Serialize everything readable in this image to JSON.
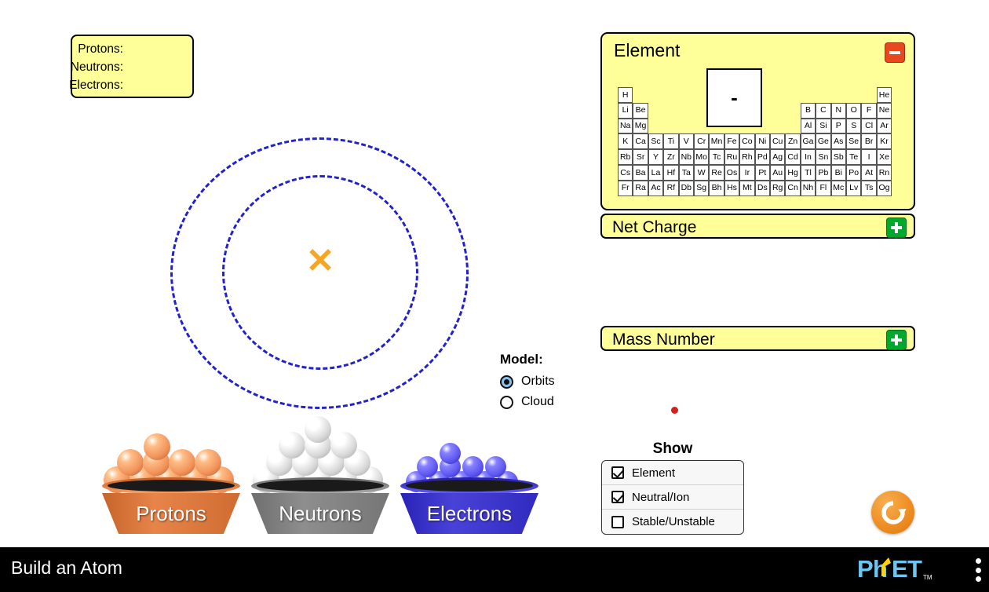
{
  "sim": {
    "title": "Build an Atom",
    "logo_text": "PhET",
    "menu_icon": "kebab-menu-icon"
  },
  "particle_counts": {
    "protons_label": "Protons:",
    "neutrons_label": "Neutrons:",
    "electrons_label": "Electrons:",
    "protons_value": "",
    "neutrons_value": "",
    "electrons_value": ""
  },
  "atom": {
    "center_marker": "✕",
    "center_marker_color": "#f5a623",
    "orbit_color": "#2222cc",
    "orbit_count": 2
  },
  "model": {
    "title": "Model:",
    "options": [
      {
        "label": "Orbits",
        "selected": true
      },
      {
        "label": "Cloud",
        "selected": false
      }
    ]
  },
  "buckets": [
    {
      "label": "Protons",
      "color": "#d9763c",
      "ball_color": "#f2935c"
    },
    {
      "label": "Neutrons",
      "color": "#808080",
      "ball_color": "#d8d8d8"
    },
    {
      "label": "Electrons",
      "color": "#3b34c9",
      "ball_color": "#5d57f0"
    }
  ],
  "element_panel": {
    "title": "Element",
    "collapse_icon": "minus-icon",
    "collapse_color": "#e8471f",
    "symbol": "-",
    "periodic_table": {
      "rows": [
        [
          "H",
          "",
          "",
          "",
          "",
          "",
          "",
          "",
          "",
          "",
          "",
          "",
          "",
          "",
          "",
          "",
          "",
          "He"
        ],
        [
          "Li",
          "Be",
          "",
          "",
          "",
          "",
          "",
          "",
          "",
          "",
          "",
          "",
          "B",
          "C",
          "N",
          "O",
          "F",
          "Ne"
        ],
        [
          "Na",
          "Mg",
          "",
          "",
          "",
          "",
          "",
          "",
          "",
          "",
          "",
          "",
          "Al",
          "Si",
          "P",
          "S",
          "Cl",
          "Ar"
        ],
        [
          "K",
          "Ca",
          "Sc",
          "Ti",
          "V",
          "Cr",
          "Mn",
          "Fe",
          "Co",
          "Ni",
          "Cu",
          "Zn",
          "Ga",
          "Ge",
          "As",
          "Se",
          "Br",
          "Kr"
        ],
        [
          "Rb",
          "Sr",
          "Y",
          "Zr",
          "Nb",
          "Mo",
          "Tc",
          "Ru",
          "Rh",
          "Pd",
          "Ag",
          "Cd",
          "In",
          "Sn",
          "Sb",
          "Te",
          "I",
          "Xe"
        ],
        [
          "Cs",
          "Ba",
          "La",
          "Hf",
          "Ta",
          "W",
          "Re",
          "Os",
          "Ir",
          "Pt",
          "Au",
          "Hg",
          "Tl",
          "Pb",
          "Bi",
          "Po",
          "At",
          "Rn"
        ],
        [
          "Fr",
          "Ra",
          "Ac",
          "Rf",
          "Db",
          "Sg",
          "Bh",
          "Hs",
          "Mt",
          "Ds",
          "Rg",
          "Cn",
          "Nh",
          "Fl",
          "Mc",
          "Lv",
          "Ts",
          "Og"
        ]
      ]
    }
  },
  "net_charge_panel": {
    "title": "Net Charge",
    "expand_icon": "plus-icon",
    "expand_color": "#00a82d",
    "collapsed": true
  },
  "mass_number_panel": {
    "title": "Mass Number",
    "expand_icon": "plus-icon",
    "expand_color": "#00a82d",
    "collapsed": true
  },
  "show_panel": {
    "title": "Show",
    "items": [
      {
        "label": "Element",
        "checked": true
      },
      {
        "label": "Neutral/Ion",
        "checked": true
      },
      {
        "label": "Stable/Unstable",
        "checked": false
      }
    ]
  },
  "reset": {
    "icon": "reset-all-icon",
    "color": "#ef8f22"
  }
}
